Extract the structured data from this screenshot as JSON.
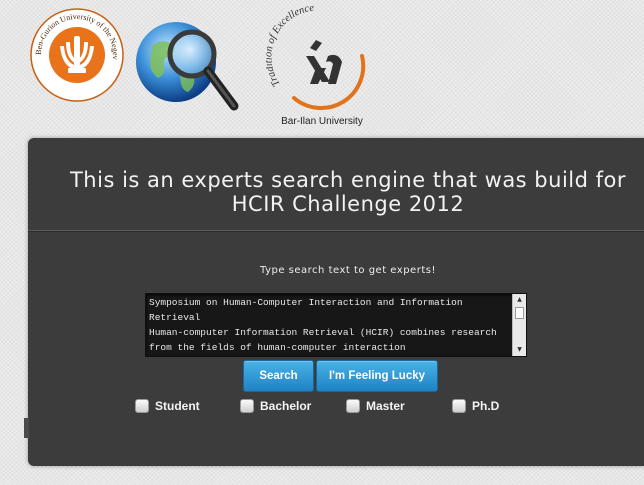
{
  "logos": {
    "bgu": {
      "icon": "ben-gurion-university-seal",
      "text": "Ben-Gurion University of the Negev"
    },
    "globe": {
      "icon": "globe-magnifier-icon"
    },
    "biu": {
      "icon": "bar-ilan-tradition-of-excellence-logo",
      "name": "Bar-Ilan University"
    }
  },
  "header": {
    "title_line1": "This is an experts search engine that was build for",
    "title_line2": "HCIR Challenge 2012"
  },
  "search": {
    "hint": "Type search text to get experts!",
    "query": "Symposium on Human-Computer Interaction and Information Retrieval\nHuman-computer Information Retrieval (HCIR) combines research from the fields of human-computer interaction",
    "search_label": "Search",
    "lucky_label": "I'm Feeling Lucky"
  },
  "filters": [
    {
      "label": "Student",
      "checked": false
    },
    {
      "label": "Bachelor",
      "checked": false
    },
    {
      "label": "Master",
      "checked": false
    },
    {
      "label": "Ph.D",
      "checked": false
    }
  ],
  "colors": {
    "panel": "#3c3c3c",
    "button": "#2a93d5",
    "bgu_orange": "#e8731a",
    "biu_orange": "#e0731c"
  }
}
